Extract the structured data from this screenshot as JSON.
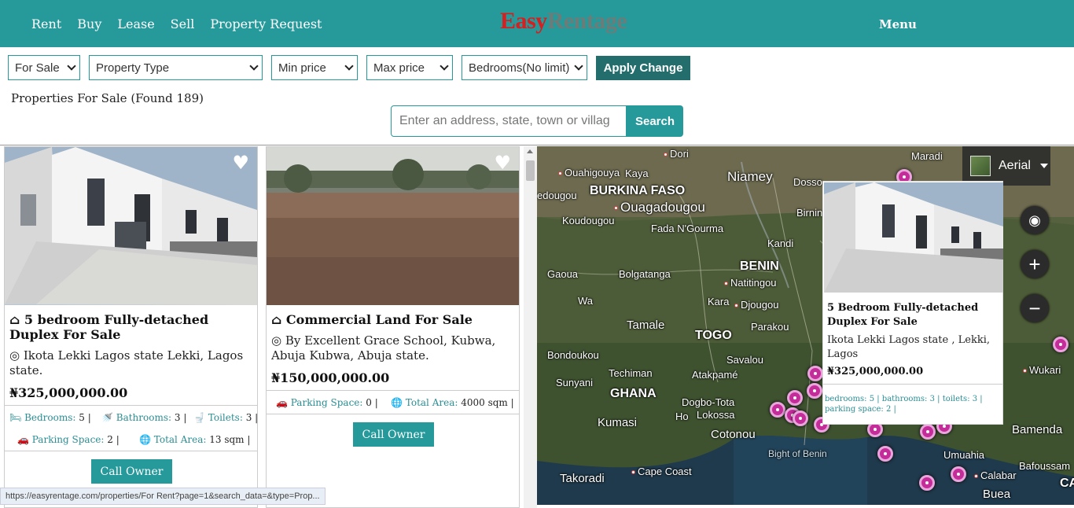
{
  "nav": {
    "links": [
      "Rent",
      "Buy",
      "Lease",
      "Sell",
      "Property Request"
    ],
    "logo_part1": "Easy",
    "logo_part2": "Rentage",
    "menu_label": "Menu"
  },
  "filters": {
    "listing_type": "For Sale",
    "property_type": "Property Type",
    "min_price": "Min price",
    "max_price": "Max price",
    "bedrooms": "Bedrooms(No limit)",
    "apply_label": "Apply Change"
  },
  "results_heading": "Properties For Sale (Found 189)",
  "search": {
    "placeholder": "Enter an address, state, town or villag",
    "button_label": "Search"
  },
  "listings": [
    {
      "title": "5 bedroom Fully-detached Duplex For Sale",
      "location": "Ikota Lekki Lagos state Lekki, Lagos state.",
      "price": "₦325,000,000.00",
      "bedrooms_label": "Bedrooms:",
      "bedrooms": "5",
      "bathrooms_label": "Bathrooms:",
      "bathrooms": "3",
      "toilets_label": "Toilets:",
      "toilets": "3",
      "parking_label": "Parking Space:",
      "parking": "2",
      "area_label": "Total Area:",
      "area": "13 sqm",
      "cta": "Call Owner"
    },
    {
      "title": "Commercial Land For Sale",
      "location": "By Excellent Grace School, Kubwa, Abuja Kubwa, Abuja state.",
      "price": "₦150,000,000.00",
      "parking_label": "Parking Space:",
      "parking": "0",
      "area_label": "Total Area:",
      "area": "4000 sqm",
      "cta": "Call Owner"
    }
  ],
  "status_url": "https://easyrentage.com/properties/For Rent?page=1&search_data=&type=Prop...",
  "map": {
    "layer_label": "Aerial",
    "places": {
      "dori": "Dori",
      "maradi": "Maradi",
      "ouahigouya": "Ouahigouya",
      "kaya": "Kaya",
      "niamey": "Niamey",
      "dosso": "Dosso",
      "dedougou": "edougou",
      "burkina": "BURKINA FASO",
      "ouaga": "Ouagadougou",
      "birnin": "Birnin",
      "koudougou": "Koudougou",
      "fada": "Fada N'Gourma",
      "kandi": "Kandi",
      "benin": "BENIN",
      "gaoua": "Gaoua",
      "bolgatanga": "Bolgatanga",
      "natitingou": "Natitingou",
      "wa": "Wa",
      "kara": "Kara",
      "djougou": "Djougou",
      "tamale": "Tamale",
      "parakou": "Parakou",
      "togo": "TOGO",
      "bondoukou": "Bondoukou",
      "savalou": "Savalou",
      "techiman": "Techiman",
      "atakpame": "Atakpamé",
      "sunyani": "Sunyani",
      "ghana": "GHANA",
      "dogbo": "Dogbo-Tota",
      "lokossa": "Lokossa",
      "ho": "Ho",
      "kumasi": "Kumasi",
      "cotonou": "Cotonou",
      "bight": "Bight of Benin",
      "takoradi": "Takoradi",
      "capecoast": "Cape Coast",
      "wukari": "Wukari",
      "bamenda": "Bamenda",
      "umuahia": "Umuahia",
      "calabar": "Calabar",
      "bafoussam": "Bafoussam",
      "buea": "Buea",
      "ca": "CA"
    },
    "popup": {
      "title": "5 Bedroom Fully-detached Duplex For Sale",
      "location": "Ikota Lekki Lagos state , Lekki, Lagos",
      "price": "₦325,000,000.00",
      "features": "bedrooms: 5 | bathrooms: 3 | toilets: 3 | parking space: 2 |"
    }
  }
}
